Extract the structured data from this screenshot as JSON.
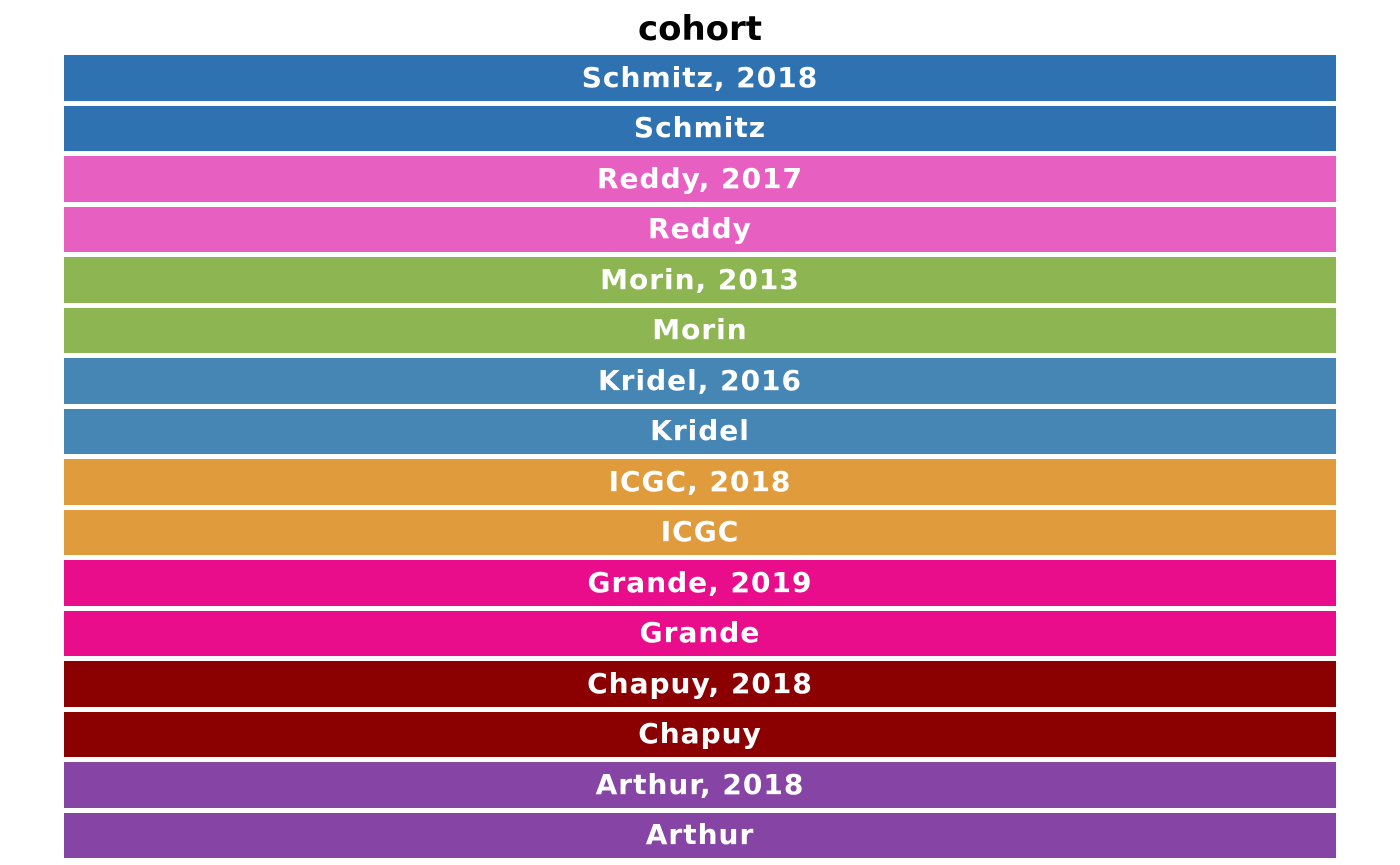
{
  "chart_data": {
    "type": "table",
    "title": "cohort",
    "swatches": [
      {
        "label": "Schmitz, 2018",
        "color": "#2E72B1"
      },
      {
        "label": "Schmitz",
        "color": "#2E72B1"
      },
      {
        "label": "Reddy, 2017",
        "color": "#E75FC0"
      },
      {
        "label": "Reddy",
        "color": "#E75FC0"
      },
      {
        "label": "Morin, 2013",
        "color": "#8DB653"
      },
      {
        "label": "Morin",
        "color": "#8DB653"
      },
      {
        "label": "Kridel, 2016",
        "color": "#4686B5"
      },
      {
        "label": "Kridel",
        "color": "#4686B5"
      },
      {
        "label": "ICGC, 2018",
        "color": "#E09C3C"
      },
      {
        "label": "ICGC",
        "color": "#E09C3C"
      },
      {
        "label": "Grande, 2019",
        "color": "#E90C8B"
      },
      {
        "label": "Grande",
        "color": "#E90C8B"
      },
      {
        "label": "Chapuy, 2018",
        "color": "#8B0000"
      },
      {
        "label": "Chapuy",
        "color": "#8B0000"
      },
      {
        "label": "Arthur, 2018",
        "color": "#8645A5"
      },
      {
        "label": "Arthur",
        "color": "#8645A5"
      }
    ]
  }
}
